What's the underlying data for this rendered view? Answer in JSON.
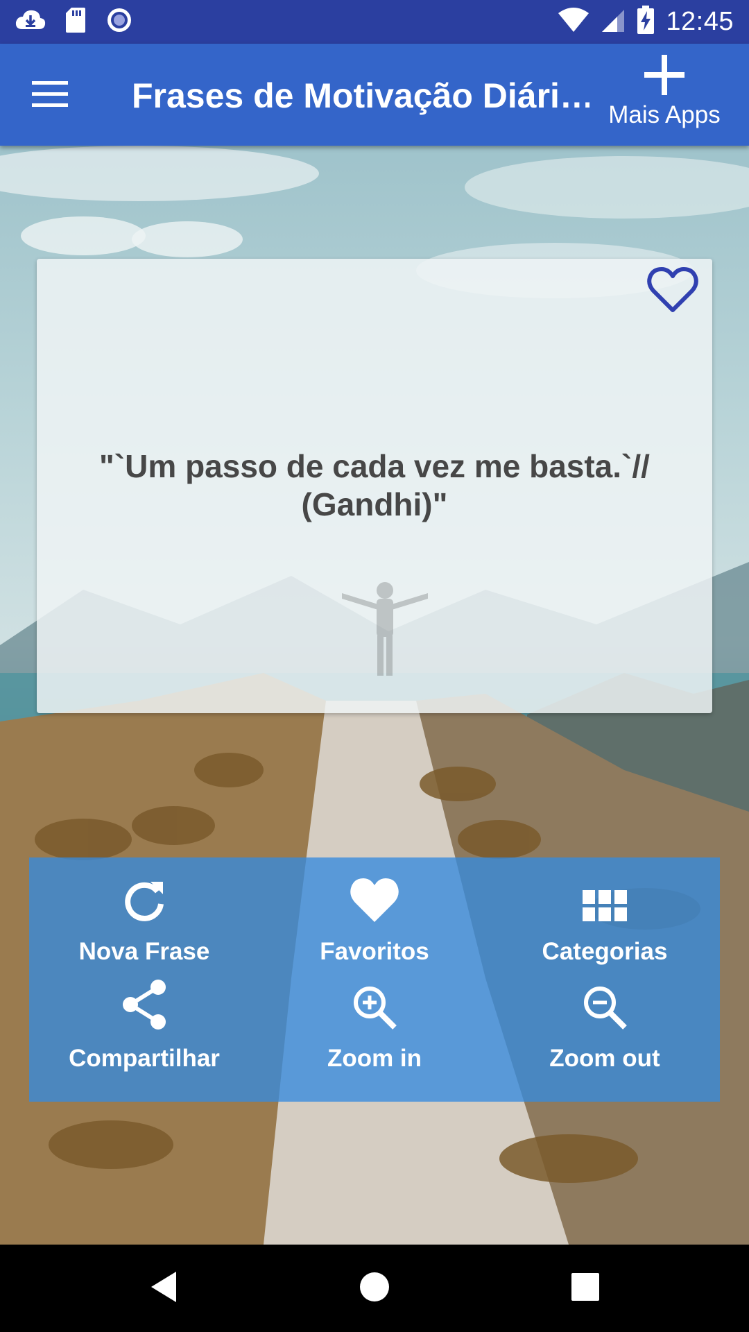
{
  "status_bar": {
    "time": "12:45",
    "left_icons": [
      "download-icon",
      "sd-card-icon",
      "record-icon"
    ],
    "right_icons": [
      "wifi-icon",
      "signal-icon",
      "battery-charging-icon"
    ]
  },
  "app_bar": {
    "menu_icon": "hamburger-menu-icon",
    "title": "Frases de Motivação Diári…",
    "more_apps_label": "Mais Apps",
    "more_apps_icon": "plus-icon"
  },
  "quote_card": {
    "text": "\"`Um passo de cada vez me basta.`// (Gandhi)\"",
    "favorite_icon": "heart-outline-icon"
  },
  "actions": [
    {
      "label": "Nova Frase",
      "icon": "refresh-icon"
    },
    {
      "label": "Favoritos",
      "icon": "heart-icon"
    },
    {
      "label": "Categorias",
      "icon": "grid-icon"
    },
    {
      "label": "Compartilhar",
      "icon": "share-icon"
    },
    {
      "label": "Zoom in",
      "icon": "zoom-in-icon"
    },
    {
      "label": "Zoom out",
      "icon": "zoom-out-icon"
    }
  ],
  "nav_bar": {
    "icons": [
      "back-icon",
      "home-icon",
      "recents-icon"
    ]
  },
  "colors": {
    "status_bar": "#2b3fa0",
    "app_bar": "#3465c9",
    "action_panel": "#368bde",
    "favorite_heart": "#3040b0",
    "quote_text": "#474747"
  }
}
